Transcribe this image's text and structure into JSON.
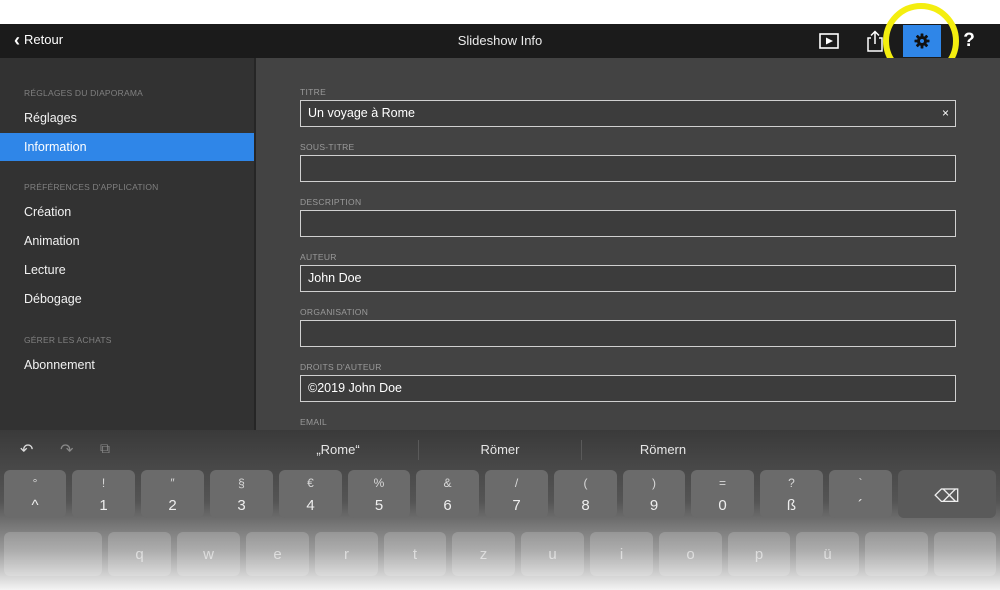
{
  "navbar": {
    "back_label": "Retour",
    "title": "Slideshow Info",
    "help_label": "?",
    "accent": "#2f86e8",
    "highlight_color": "#f4ee0f"
  },
  "sidebar": {
    "section1": "RÉGLAGES DU DIAPORAMA",
    "item_reglages": "Réglages",
    "item_information": "Information",
    "section2": "PRÉFÉRENCES D'APPLICATION",
    "item_creation": "Création",
    "item_animation": "Animation",
    "item_lecture": "Lecture",
    "item_debogage": "Débogage",
    "section3": "GÉRER LES ACHATS",
    "item_abonnement": "Abonnement"
  },
  "form": {
    "titre_label": "TITRE",
    "titre_value": "Un voyage à Rome",
    "clear": "×",
    "soustitre_label": "SOUS-TITRE",
    "soustitre_value": "",
    "description_label": "DESCRIPTION",
    "description_value": "",
    "auteur_label": "AUTEUR",
    "auteur_value": "John Doe",
    "organisation_label": "ORGANISATION",
    "organisation_value": "",
    "droits_label": "DROITS D'AUTEUR",
    "droits_value": "©2019 John Doe",
    "email_label": "EMAIL"
  },
  "keyboard": {
    "suggestions": [
      "„Rome“",
      "Römer",
      "Römern"
    ],
    "undo": "↶",
    "redo": "↷",
    "paste": "⧉",
    "number_keys": [
      {
        "top": "°",
        "bottom": "^"
      },
      {
        "top": "!",
        "bottom": "1"
      },
      {
        "top": "″",
        "bottom": "2"
      },
      {
        "top": "§",
        "bottom": "3"
      },
      {
        "top": "€",
        "bottom": "4"
      },
      {
        "top": "%",
        "bottom": "5"
      },
      {
        "top": "&",
        "bottom": "6"
      },
      {
        "top": "/",
        "bottom": "7"
      },
      {
        "top": "(",
        "bottom": "8"
      },
      {
        "top": ")",
        "bottom": "9"
      },
      {
        "top": "=",
        "bottom": "0"
      },
      {
        "top": "?",
        "bottom": "ß"
      },
      {
        "top": "`",
        "bottom": "´"
      }
    ],
    "letter_keys": [
      "q",
      "w",
      "e",
      "r",
      "t",
      "z",
      "u",
      "i",
      "o",
      "p",
      "ü"
    ],
    "backspace": "⌫"
  }
}
